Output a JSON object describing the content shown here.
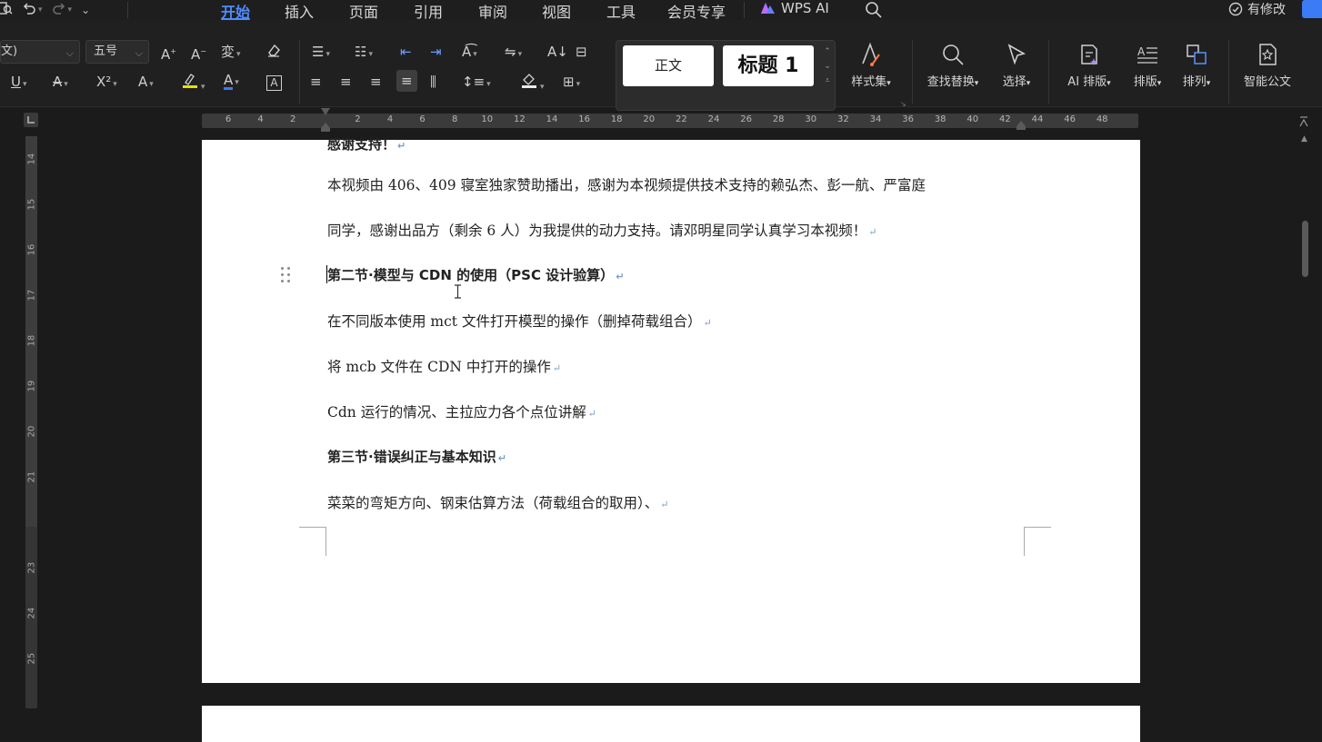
{
  "menubar": {
    "left_icons": [
      "document-icon",
      "undo-icon",
      "redo-icon",
      "more-chevron-icon"
    ],
    "tabs": [
      {
        "label": "开始",
        "active": true
      },
      {
        "label": "插入"
      },
      {
        "label": "页面"
      },
      {
        "label": "引用"
      },
      {
        "label": "审阅"
      },
      {
        "label": "视图"
      },
      {
        "label": "工具"
      },
      {
        "label": "会员专享"
      }
    ],
    "wps_ai": "WPS AI",
    "status": "有修改"
  },
  "ribbon": {
    "font_name": "文)",
    "font_size": "五号",
    "styles": {
      "normal": "正文",
      "heading1": "标题 1"
    },
    "buttons": {
      "style_set": "样式集",
      "find_replace": "查找替换",
      "select": "选择",
      "ai_layout": "AI 排版",
      "layout": "排版",
      "arrange": "排列",
      "smart_doc": "智能公文"
    }
  },
  "ruler": {
    "h_numbers": [
      "6",
      "4",
      "2",
      "2",
      "4",
      "6",
      "8",
      "10",
      "12",
      "14",
      "16",
      "18",
      "20",
      "22",
      "24",
      "26",
      "28",
      "30",
      "32",
      "34",
      "36",
      "38",
      "40",
      "42",
      "44",
      "46",
      "48"
    ],
    "v_numbers": [
      "14",
      "15",
      "16",
      "17",
      "18",
      "19",
      "20",
      "21",
      "23",
      "24",
      "25"
    ]
  },
  "document": {
    "cutoff_line": "感谢支持！",
    "lines": [
      "本视频由 406、409 寝室独家赞助播出，感谢为本视频提供技术支持的赖弘杰、彭一航、严富庭",
      "同学，感谢出品方（剩余 6 人）为我提供的动力支持。请邓明星同学认真学习本视频！",
      "第二节·模型与 CDN 的使用（PSC 设计验算）",
      "在不同版本使用 mct 文件打开模型的操作（删掉荷载组合）",
      "将 mcb 文件在 CDN 中打开的操作",
      "Cdn 运行的情况、主拉应力各个点位讲解",
      "第三节·错误纠正与基本知识",
      "菜菜的弯矩方向、钢束估算方法（荷载组合的取用）、"
    ],
    "paragraph_mark": "↵"
  },
  "colors": {
    "accent": "#4e8cff",
    "ui_bg": "#1b1b1b",
    "page_bg": "#ffffff",
    "text": "#222222"
  }
}
